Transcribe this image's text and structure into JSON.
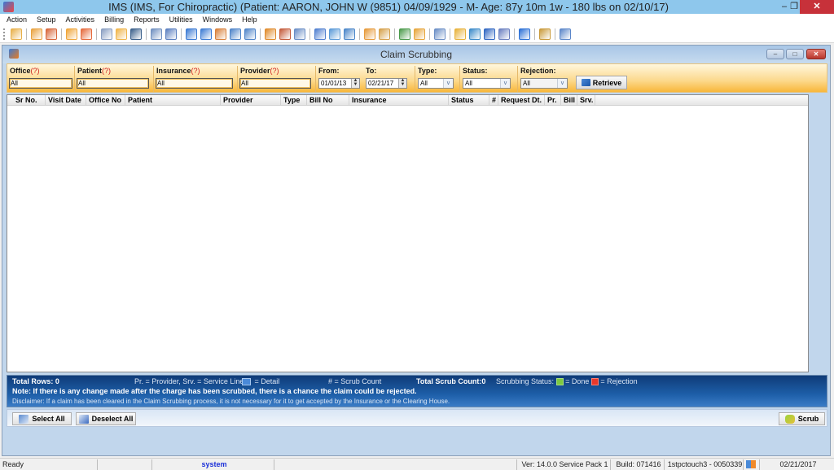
{
  "window": {
    "title": "IMS (IMS, For Chiropractic)    (Patient: AARON, JOHN W (9851) 04/09/1929 - M- Age: 87y 10m 1w - 180 lbs on 02/10/17)",
    "minimize": "–",
    "restore": "❐",
    "close": "✕"
  },
  "menu": [
    "Action",
    "Setup",
    "Activities",
    "Billing",
    "Reports",
    "Utilities",
    "Windows",
    "Help"
  ],
  "toolbar": {
    "groups": [
      [
        {
          "name": "patient-icon",
          "color": "#e8b04a"
        }
      ],
      [
        {
          "name": "patient-add-icon",
          "color": "#e9a23f"
        },
        {
          "name": "patient-check-icon",
          "color": "#d8663a"
        }
      ],
      [
        {
          "name": "folder-icon",
          "color": "#f0a63a"
        },
        {
          "name": "edit-note-icon",
          "color": "#e6693b"
        }
      ],
      [
        {
          "name": "clipboard-icon",
          "color": "#8a9fc2"
        },
        {
          "name": "flask-icon",
          "color": "#f0b54a"
        },
        {
          "name": "shield-icon",
          "color": "#3a5f8a"
        }
      ],
      [
        {
          "name": "document-icon",
          "color": "#6f8fc0"
        },
        {
          "name": "notepad-icon",
          "color": "#5a7fc0"
        }
      ],
      [
        {
          "name": "sync-icon",
          "color": "#3c7bd4"
        },
        {
          "name": "billing-sync-icon",
          "color": "#3c7bd4"
        },
        {
          "name": "users-money-icon",
          "color": "#d9803a"
        },
        {
          "name": "payment-icon",
          "color": "#4e84c9"
        },
        {
          "name": "payment-user-icon",
          "color": "#4e84c9"
        }
      ],
      [
        {
          "name": "calendar-grid-icon",
          "color": "#e08a2a"
        },
        {
          "name": "scheduler-icon",
          "color": "#c45a3a"
        },
        {
          "name": "report-chart-icon",
          "color": "#6a8ec6"
        }
      ],
      [
        {
          "name": "pen-icon",
          "color": "#4f7fd0"
        },
        {
          "name": "box-icon",
          "color": "#5a9ad8"
        },
        {
          "name": "box-send-icon",
          "color": "#4a86c9"
        }
      ],
      [
        {
          "name": "calendar-edit-icon",
          "color": "#e79a3a"
        },
        {
          "name": "checklist-icon",
          "color": "#d6a04a"
        }
      ],
      [
        {
          "name": "bar-chart-icon",
          "color": "#4a9a4a"
        },
        {
          "name": "folder-user-icon",
          "color": "#e7a53a"
        }
      ],
      [
        {
          "name": "report-building-icon",
          "color": "#6a8ec6"
        }
      ],
      [
        {
          "name": "transfer-icon",
          "color": "#e8b23a"
        },
        {
          "name": "exchange-icon",
          "color": "#3a8ac9"
        },
        {
          "name": "word-icon",
          "color": "#2f66c2"
        },
        {
          "name": "schedule-alert-icon",
          "color": "#6a7fc0"
        }
      ],
      [
        {
          "name": "help-icon",
          "color": "#2a6fd6"
        }
      ],
      [
        {
          "name": "lock-icon",
          "color": "#c99a3a"
        }
      ],
      [
        {
          "name": "exit-icon",
          "color": "#5a86c9"
        }
      ]
    ]
  },
  "child_window": {
    "title": "Claim Scrubbing",
    "minimize": "–",
    "maximize": "□",
    "close": "✕"
  },
  "filters": {
    "office": {
      "label": "Office",
      "help": "(?)",
      "value": "All"
    },
    "patient": {
      "label": "Patient",
      "help": "(?)",
      "value": "All"
    },
    "insurance": {
      "label": "Insurance",
      "help": "(?)",
      "value": "All"
    },
    "provider": {
      "label": "Provider",
      "help": "(?)",
      "value": "All"
    },
    "from": {
      "label": "From:",
      "value": "01/01/13"
    },
    "to": {
      "label": "To:",
      "value": "02/21/17"
    },
    "type": {
      "label": "Type:",
      "value": "All"
    },
    "status": {
      "label": "Status:",
      "value": "All"
    },
    "rejection": {
      "label": "Rejection:",
      "value": "All"
    },
    "retrieve_label": "Retrieve"
  },
  "grid": {
    "columns": [
      "Sr No.",
      "Visit Date",
      "Office No",
      "Patient",
      "Provider",
      "Type",
      "Bill No",
      "Insurance",
      "Status",
      "#",
      "Request Dt.",
      "Pr.",
      "Bill",
      "Srv."
    ],
    "rows": []
  },
  "legend": {
    "total_rows": "Total Rows: 0",
    "pr_srv": "Pr. = Provider, Srv. = Service Line",
    "detail": "= Detail",
    "scrub_count": "# = Scrub Count",
    "total_scrub_count": "Total Scrub Count:0",
    "scrubbing_status": "Scrubbing Status:",
    "done": "= Done",
    "rejection": "= Rejection",
    "note": "Note: If there is any change made after the charge has been scrubbed, there is a chance the claim could be rejected.",
    "disclaimer": "Disclaimer: If a claim has been cleared in the Claim Scrubbing process, it is not necessary for it to get accepted by the Insurance or the Clearing House.",
    "colors": {
      "done": "#7cc940",
      "rejection": "#e8382c"
    }
  },
  "buttons": {
    "select_all": "Select All",
    "deselect_all": "Deselect All",
    "scrub": "Scrub"
  },
  "statusbar": {
    "ready": "Ready",
    "user": "system",
    "version": "Ver: 14.0.0 Service Pack 1",
    "build": "Build: 071416",
    "machine": "1stpctouch3 - 0050339",
    "date": "02/21/2017"
  }
}
